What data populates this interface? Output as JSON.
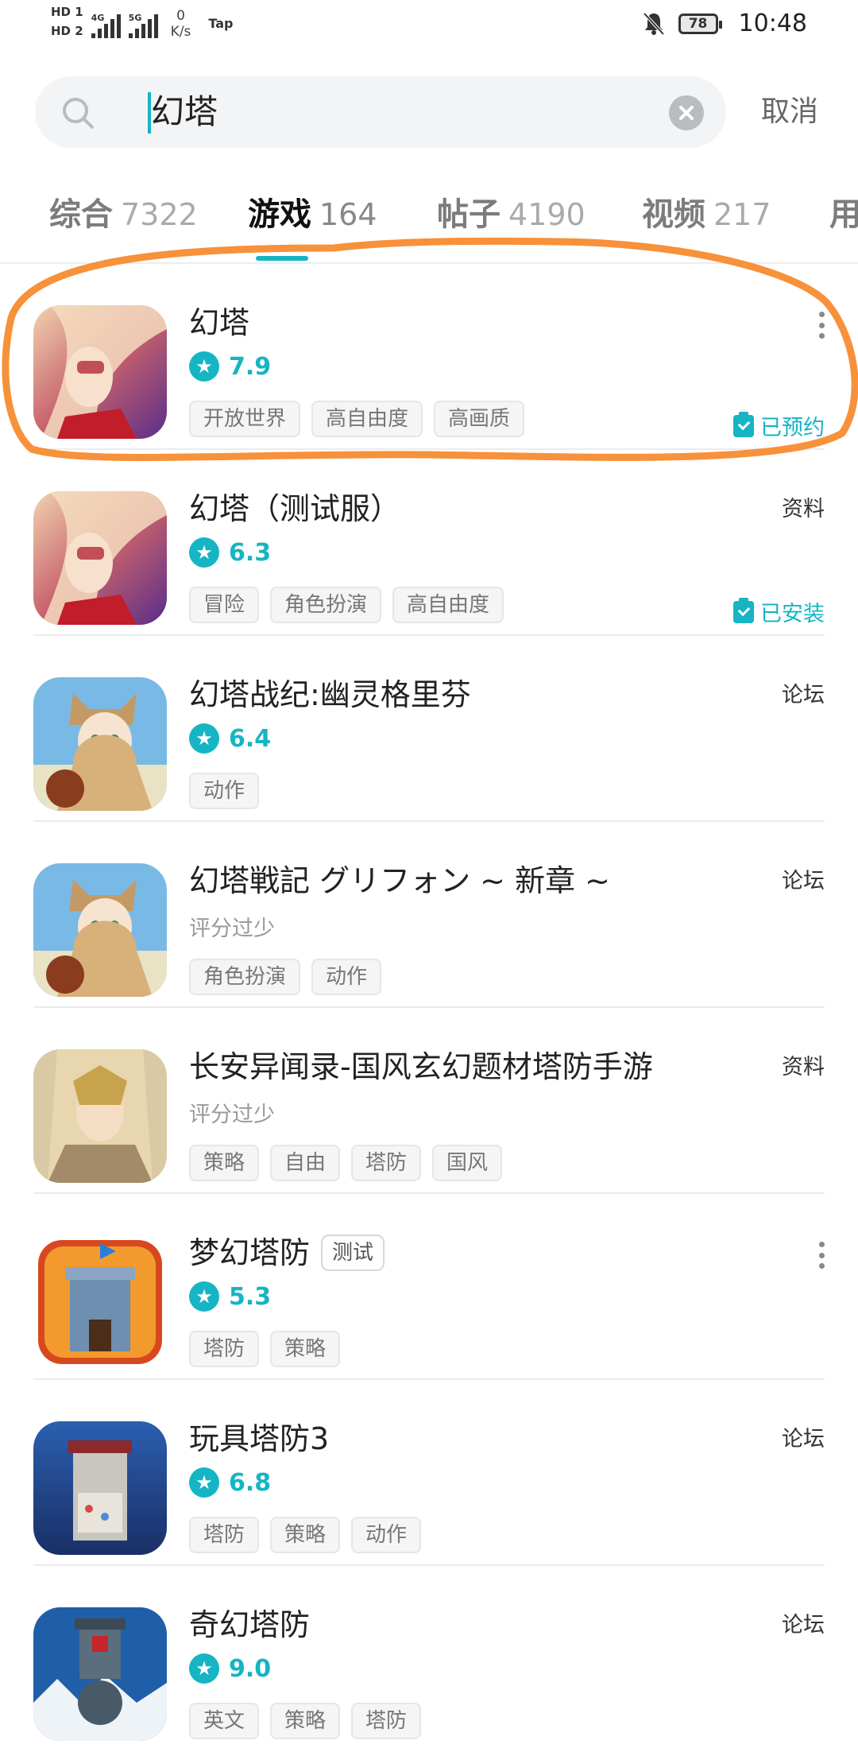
{
  "status_bar": {
    "hd1": "HD 1",
    "hd2": "HD 2",
    "net1": "4G",
    "net2": "5G",
    "speed_value": "0",
    "speed_unit": "K/s",
    "tap_label": "Tap",
    "battery": "78",
    "time": "10:48"
  },
  "search": {
    "query": "幻塔",
    "cancel_label": "取消"
  },
  "tabs": [
    {
      "label": "综合",
      "count": "7322",
      "active": false
    },
    {
      "label": "游戏",
      "count": "164",
      "active": true
    },
    {
      "label": "帖子",
      "count": "4190",
      "active": false
    },
    {
      "label": "视频",
      "count": "217",
      "active": false
    },
    {
      "label": "用",
      "count": "",
      "active": false
    }
  ],
  "games": [
    {
      "title": "幻塔",
      "rating": "7.9",
      "tags": [
        "开放世界",
        "高自由度",
        "高画质"
      ],
      "action": "more",
      "status": "已预约",
      "icon": "tower-of-fantasy-icon"
    },
    {
      "title": "幻塔（测试服）",
      "rating": "6.3",
      "tags": [
        "冒险",
        "角色扮演",
        "高自由度"
      ],
      "action": "资料",
      "status": "已安装",
      "icon": "tower-of-fantasy-icon"
    },
    {
      "title": "幻塔战纪:幽灵格里芬",
      "rating": "6.4",
      "tags": [
        "动作"
      ],
      "action": "论坛",
      "icon": "phantom-griffin-icon"
    },
    {
      "title": "幻塔戦記 グリフォン ~ 新章 ~",
      "rating_text": "评分过少",
      "tags": [
        "角色扮演",
        "动作"
      ],
      "action": "论坛",
      "icon": "griffin-new-chapter-icon"
    },
    {
      "title": "长安异闻录-国风玄幻题材塔防手游",
      "rating_text": "评分过少",
      "tags": [
        "策略",
        "自由",
        "塔防",
        "国风"
      ],
      "action": "资料",
      "icon": "changan-icon"
    },
    {
      "title": "梦幻塔防",
      "badge": "测试",
      "rating": "5.3",
      "tags": [
        "塔防",
        "策略"
      ],
      "action": "more",
      "icon": "dream-tower-defense-icon"
    },
    {
      "title": "玩具塔防3",
      "rating": "6.8",
      "tags": [
        "塔防",
        "策略",
        "动作"
      ],
      "action": "论坛",
      "icon": "toy-defense-icon"
    },
    {
      "title": "奇幻塔防",
      "rating": "9.0",
      "tags": [
        "英文",
        "策略",
        "塔防"
      ],
      "action": "论坛",
      "icon": "fantasy-tower-defense-icon"
    }
  ],
  "colors": {
    "accent": "#15b5c3",
    "highlight_ring": "#f7913a"
  }
}
